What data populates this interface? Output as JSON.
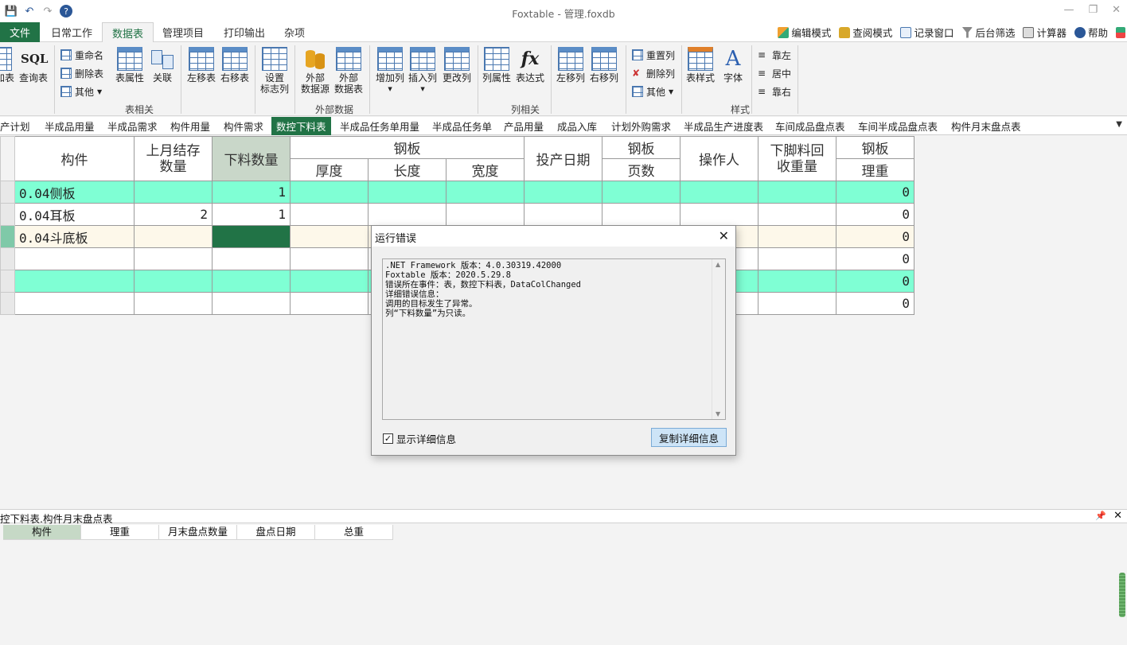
{
  "window": {
    "title": "Foxtable - 管理.foxdb"
  },
  "menu": {
    "file": "文件",
    "tabs": [
      "日常工作",
      "数据表",
      "管理项目",
      "打印输出",
      "杂项"
    ],
    "right": [
      "编辑模式",
      "查阅模式",
      "记录窗口",
      "后台筛选",
      "计算器",
      "帮助"
    ]
  },
  "ribbon": {
    "partial": {
      "add_table": "加表",
      "sql": "SQL",
      "query_table": "查询表"
    },
    "table_group": {
      "label": "表相关",
      "rename": "重命名",
      "delete_table": "删除表",
      "other": "其他",
      "table_props": "表属性",
      "relation": "关联",
      "move_left": "左移表",
      "move_right": "右移表",
      "set_flag_col_1": "设置",
      "set_flag_col_2": "标志列"
    },
    "external_group": {
      "label": "外部数据",
      "source_1": "外部",
      "source_2": "数据源",
      "table_1": "外部",
      "table_2": "数据表"
    },
    "column_group": {
      "label": "列相关",
      "add_col": "增加列",
      "insert_col": "插入列",
      "change_col": "更改列",
      "col_props": "列属性",
      "expression": "表达式",
      "move_left": "左移列",
      "move_right": "右移列",
      "reset_col": "重置列",
      "delete_col": "删除列",
      "other": "其他"
    },
    "style_group": {
      "label": "样式",
      "table_style": "表样式",
      "font": "字体",
      "align_left": "靠左",
      "align_center": "居中",
      "align_right": "靠右"
    }
  },
  "sheet_tabs": [
    "产计划",
    "半成品用量",
    "半成品需求",
    "构件用量",
    "构件需求",
    "数控下料表",
    "半成品任务单用量",
    "半成品任务单",
    "产品用量",
    "成品入库",
    "计划外购需求",
    "半成品生产进度表",
    "车间成品盘点表",
    "车间半成品盘点表",
    "构件月末盘点表"
  ],
  "grid": {
    "headers": {
      "component": "构件",
      "last_stock_1": "上月结存",
      "last_stock_2": "数量",
      "cut_qty": "下料数量",
      "steel_plate": "钢板",
      "thickness": "厚度",
      "length": "长度",
      "width": "宽度",
      "production_date": "投产日期",
      "plate_pages_1": "钢板",
      "plate_pages_2": "页数",
      "operator": "操作人",
      "scrap_1": "下脚料回",
      "scrap_2": "收重量",
      "theoretical_1": "钢板",
      "theoretical_2": "理重"
    },
    "rows": [
      {
        "component": "0.04侧板",
        "last_stock": "",
        "cut_qty": "1",
        "theoretical": "0"
      },
      {
        "component": "0.04耳板",
        "last_stock": "2",
        "cut_qty": "1",
        "theoretical": "0"
      },
      {
        "component": "0.04斗底板",
        "last_stock": "",
        "cut_qty": "",
        "theoretical": "0"
      },
      {
        "component": "",
        "last_stock": "",
        "cut_qty": "",
        "theoretical": "0"
      },
      {
        "component": "",
        "last_stock": "",
        "cut_qty": "",
        "theoretical": "0"
      },
      {
        "component": "",
        "last_stock": "",
        "cut_qty": "",
        "theoretical": "0"
      }
    ]
  },
  "dialog": {
    "title": "运行错误",
    "lines": [
      ".NET Framework 版本：4.0.30319.42000",
      "Foxtable 版本：2020.5.29.8",
      "错误所在事件：表，数控下料表，DataColChanged",
      "详细错误信息：",
      "调用的目标发生了异常。",
      "列“下料数量”为只读。"
    ],
    "show_details": "显示详细信息",
    "copy_button": "复制详细信息"
  },
  "bottom_panel": {
    "title": "控下料表.构件月末盘点表",
    "columns": [
      "构件",
      "理重",
      "月末盘点数量",
      "盘点日期",
      "总重"
    ]
  },
  "colors": {
    "accent": "#217346",
    "row_green": "#7fffd4",
    "row_cream": "#fdf8ea"
  }
}
